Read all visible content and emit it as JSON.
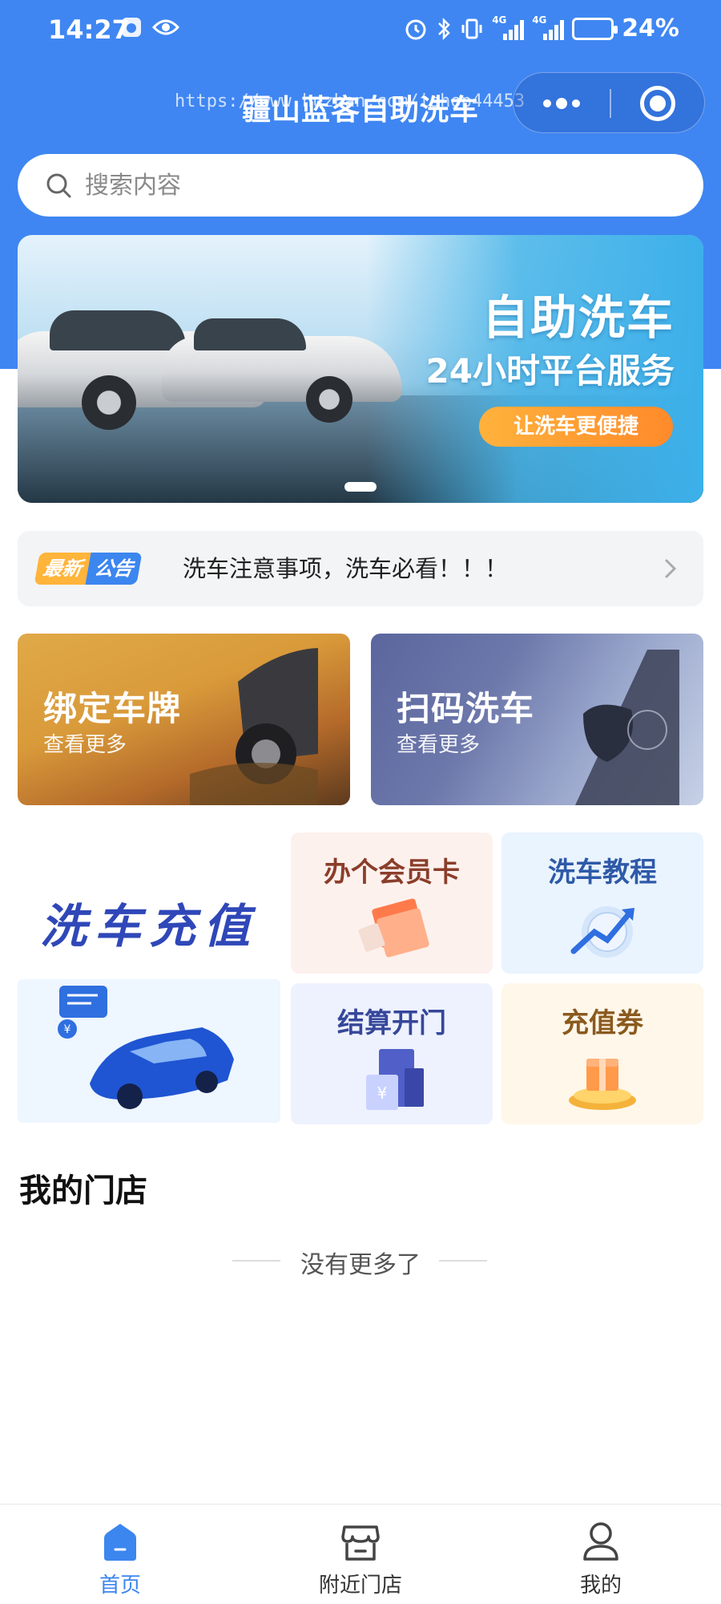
{
  "status_bar": {
    "time": "14:27",
    "battery": "24%",
    "net1": "4G",
    "net2": "4G"
  },
  "header": {
    "title": "疆山蓝客自助洗车",
    "watermark": "https://www.huzhan.com/ishop44453"
  },
  "search": {
    "placeholder": "搜索内容"
  },
  "banner": {
    "headline": "自助洗车",
    "subheadline": "24小时平台服务",
    "button": "让洗车更便捷"
  },
  "notice": {
    "badge_new": "最新",
    "badge_notice": "公告",
    "text": "洗车注意事项，洗车必看！！！"
  },
  "cards": [
    {
      "title": "绑定车牌",
      "subtitle": "查看更多"
    },
    {
      "title": "扫码洗车",
      "subtitle": "查看更多"
    }
  ],
  "grid": {
    "recharge": "洗车充值",
    "member_card": "办个会员卡",
    "tutorial": "洗车教程",
    "checkout": "结算开门",
    "coupon": "充值券"
  },
  "my_store": {
    "title": "我的门店",
    "empty": "没有更多了"
  },
  "tabbar": [
    {
      "label": "首页",
      "active": true,
      "icon": "home-icon"
    },
    {
      "label": "附近门店",
      "active": false,
      "icon": "store-icon"
    },
    {
      "label": "我的",
      "active": false,
      "icon": "user-icon"
    }
  ],
  "colors": {
    "primary": "#3f86f2",
    "tab_active": "#3c86ef",
    "recharge_text": "#2f47b8",
    "banner_button": "#ff8a2a"
  }
}
